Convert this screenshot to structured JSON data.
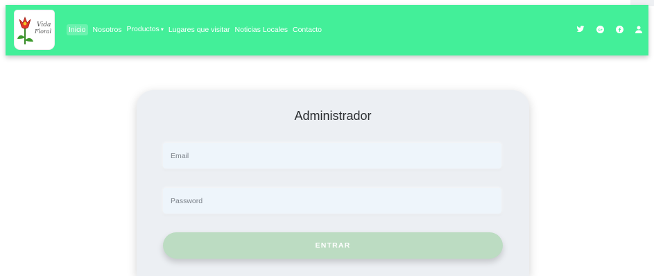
{
  "brand": {
    "logo_text_line1": "Vida",
    "logo_text_line2": "Floral"
  },
  "nav": {
    "items": [
      {
        "label": "Inicio",
        "active": true
      },
      {
        "label": "Nosotros"
      },
      {
        "label": "Productos",
        "dropdown": true
      },
      {
        "label": "Lugares que visitar"
      },
      {
        "label": "Noticias Locales"
      },
      {
        "label": "Contacto"
      }
    ]
  },
  "social": [
    "twitter-icon",
    "google-plus-icon",
    "facebook-icon",
    "user-icon"
  ],
  "login": {
    "title": "Administrador",
    "email_placeholder": "Email",
    "password_placeholder": "Password",
    "submit_label": "ENTRAR"
  },
  "colors": {
    "navbar": "#43ef99",
    "card": "#eceff3",
    "input": "#eef5fb",
    "button": "#bcdcc2",
    "nav_text": "#ffffff"
  }
}
